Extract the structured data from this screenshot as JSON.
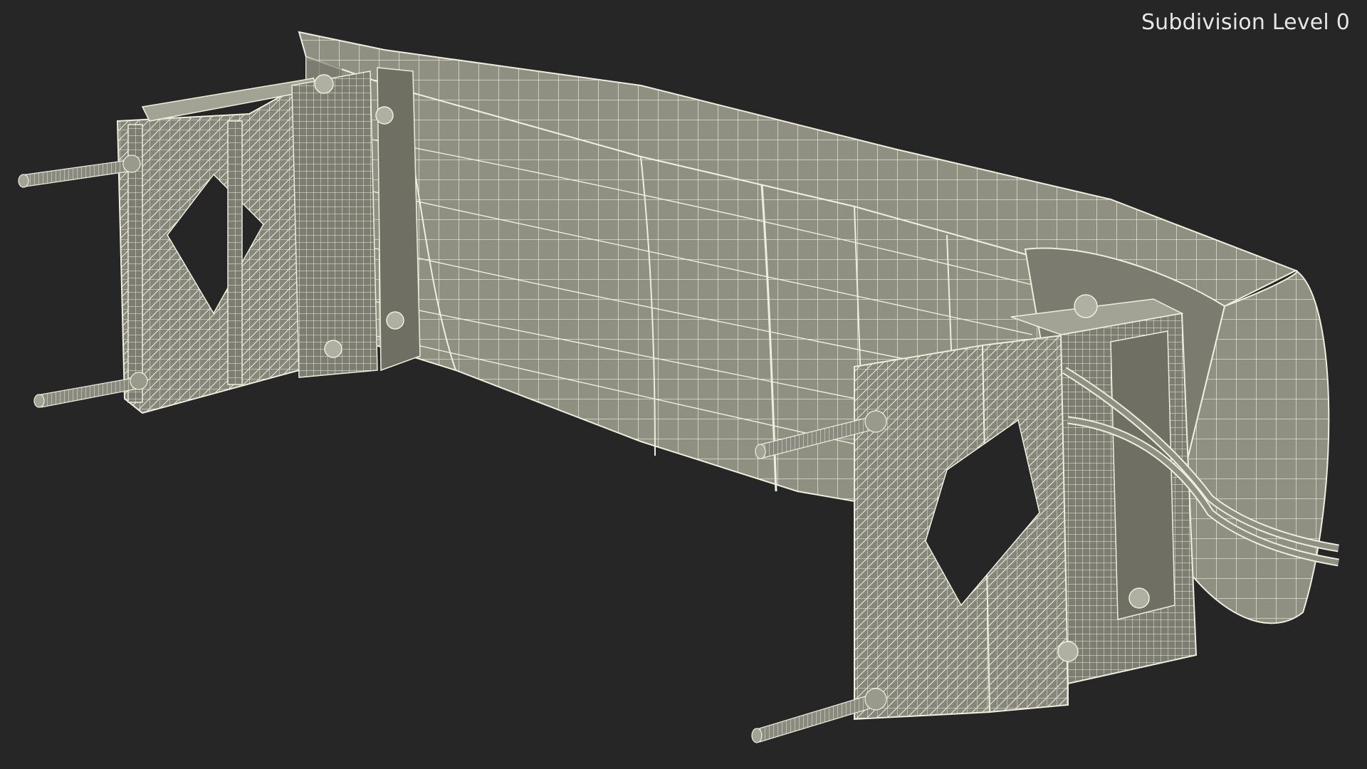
{
  "viewport": {
    "label": "Subdivision Level 0"
  },
  "model": {
    "parts": [
      "main-housing-body",
      "end-cap",
      "left-mounting-bracket",
      "right-mounting-bracket",
      "threaded-rods",
      "cables",
      "bolts"
    ]
  },
  "colors": {
    "background": "#262626",
    "surface": "#8f8f82",
    "surface_light": "#a3a395",
    "surface_dark": "#6f6f64",
    "wire": "#f0efe2",
    "shadow": "#4a4a42"
  }
}
